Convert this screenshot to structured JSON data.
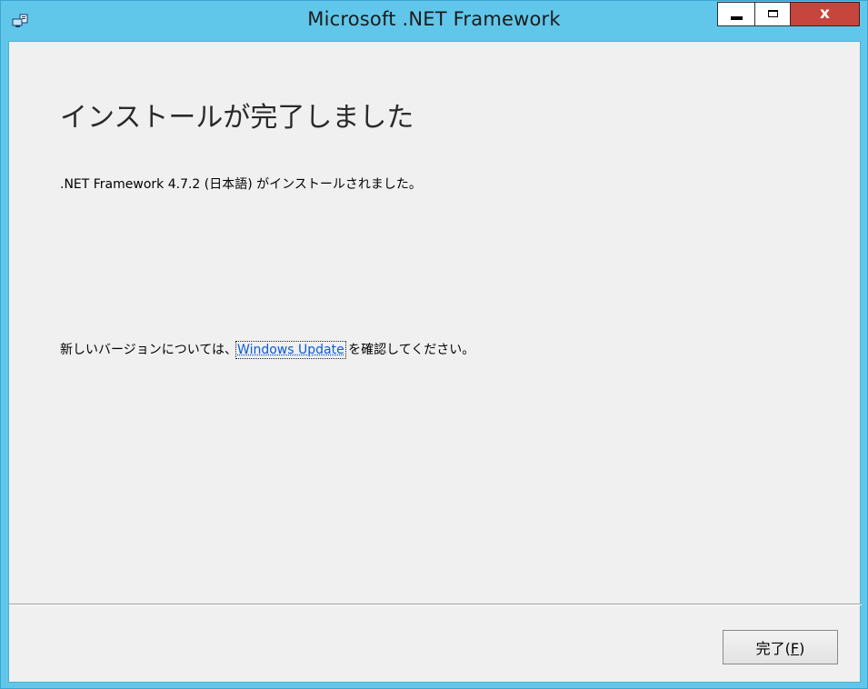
{
  "window": {
    "title": "Microsoft .NET Framework",
    "icon": "setup-computer-icon",
    "controls": {
      "minimize_icon": "minimize-icon",
      "maximize_icon": "maximize-icon",
      "close_label": "x"
    },
    "colors": {
      "frame": "#61c7ea",
      "client_background": "#f0f0f0",
      "close_button": "#c6453d",
      "link": "#0b5bd7"
    }
  },
  "content": {
    "heading": "インストールが完了しました",
    "installed_message": ".NET Framework 4.7.2 (日本語) がインストールされました。",
    "update_prefix": "新しいバージョンについては、",
    "update_link": "Windows Update",
    "update_suffix": " を確認してください。"
  },
  "footer": {
    "finish_label_prefix": "完了(",
    "finish_accelerator": "F",
    "finish_label_suffix": ")"
  }
}
